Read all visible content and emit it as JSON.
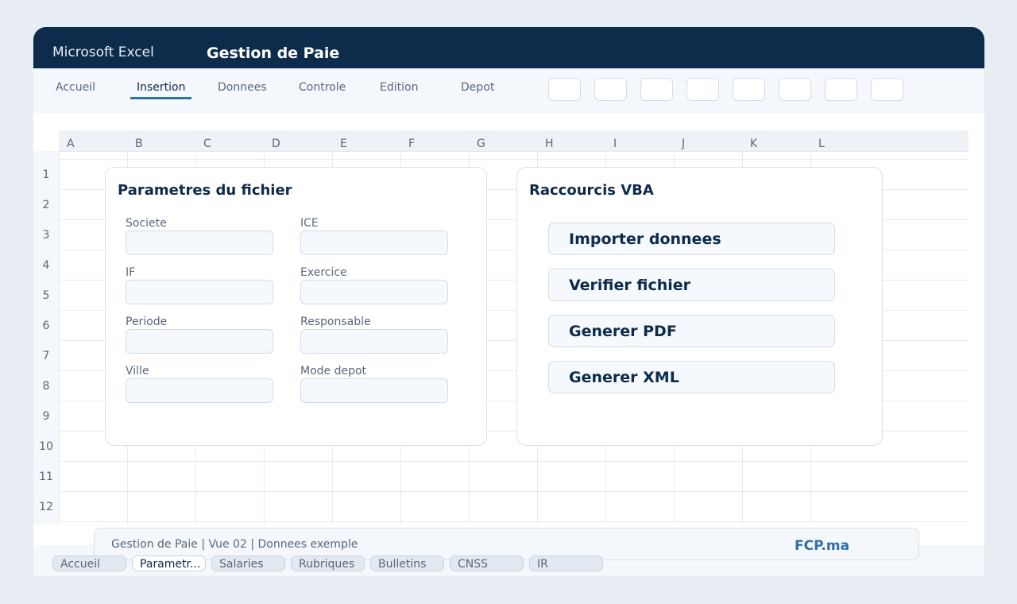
{
  "app": {
    "name": "Microsoft Excel",
    "title": "Gestion de Paie"
  },
  "ribbon": {
    "tabs": [
      "Accueil",
      "Insertion",
      "Donnees",
      "Controle",
      "Edition",
      "Depot"
    ],
    "active_tab": "Insertion"
  },
  "grid": {
    "columns": [
      "A",
      "B",
      "C",
      "D",
      "E",
      "F",
      "G",
      "H",
      "I",
      "J",
      "K",
      "L"
    ],
    "rows": [
      "1",
      "2",
      "3",
      "4",
      "5",
      "6",
      "7",
      "8",
      "9",
      "10",
      "11",
      "12"
    ]
  },
  "params_card": {
    "title": "Parametres du fichier",
    "fields": [
      {
        "label": "Societe",
        "value": ""
      },
      {
        "label": "ICE",
        "value": ""
      },
      {
        "label": "IF",
        "value": ""
      },
      {
        "label": "Exercice",
        "value": ""
      },
      {
        "label": "Periode",
        "value": ""
      },
      {
        "label": "Responsable",
        "value": ""
      },
      {
        "label": "Ville",
        "value": ""
      },
      {
        "label": "Mode depot",
        "value": ""
      }
    ]
  },
  "vba_card": {
    "title": "Raccourcis VBA",
    "buttons": [
      "Importer donnees",
      "Verifier fichier",
      "Generer PDF",
      "Generer XML"
    ]
  },
  "status_bar": {
    "text": "Gestion de Paie | Vue 02 | Donnees exemple",
    "brand": "FCP.ma"
  },
  "sheet_tabs": [
    "Accueil",
    "Parametr...",
    "Salaries",
    "Rubriques",
    "Bulletins",
    "CNSS",
    "IR"
  ],
  "active_sheet": "Parametr...",
  "colors": {
    "titlebar": "#0d2b4a",
    "accent": "#2f6fa8",
    "text": "#5b6778"
  }
}
